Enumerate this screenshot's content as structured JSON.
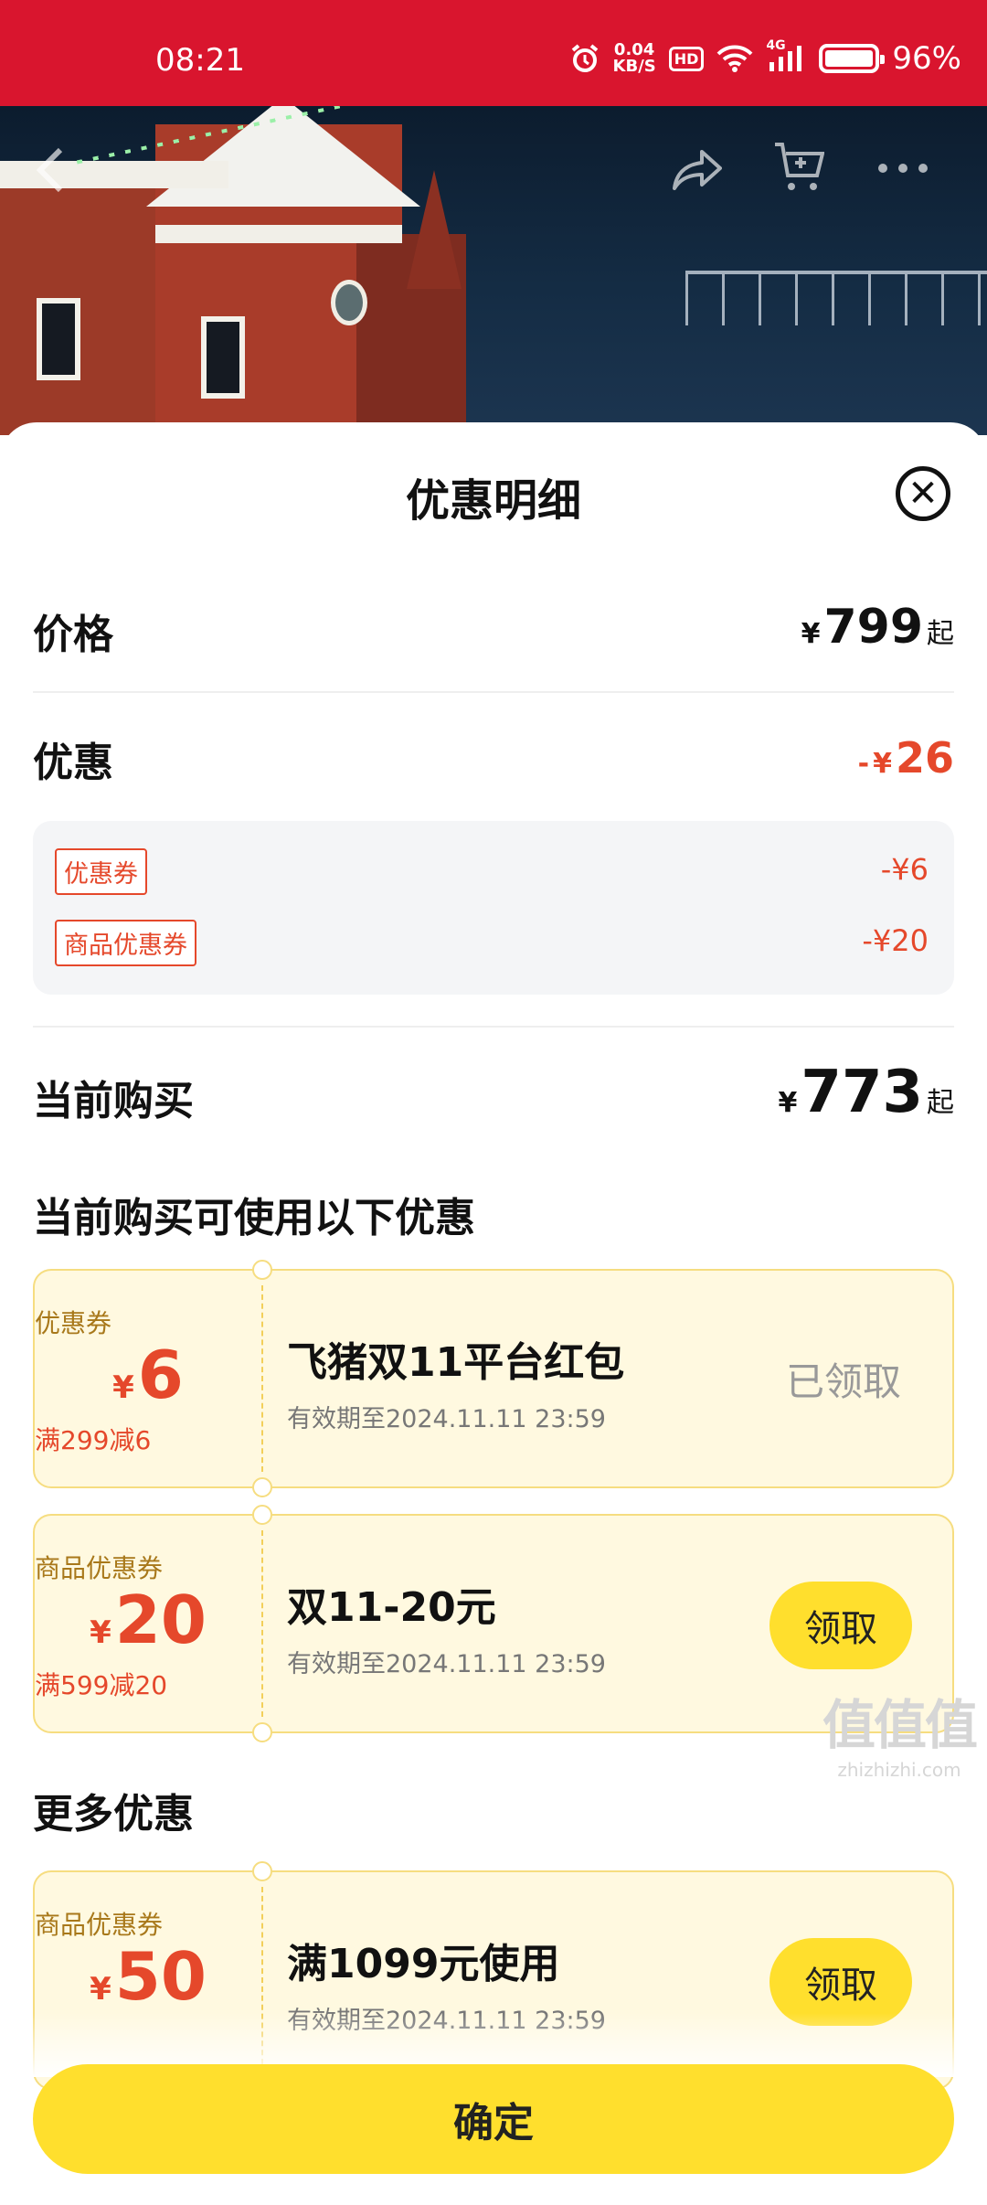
{
  "status_bar": {
    "time": "08:21",
    "net_speed_value": "0.04",
    "net_speed_unit": "KB/S",
    "hd": "HD",
    "signal": "4G",
    "battery": "96%"
  },
  "colors": {
    "status_bar_bg": "#d9152e",
    "accent_red": "#e5482b",
    "accent_yellow": "#ffdf2d",
    "coupon_bg": "#fff9e0"
  },
  "icons": {
    "back": "back-arrow-icon",
    "share": "share-icon",
    "cart": "cart-icon",
    "more": "more-icon",
    "close": "close-icon"
  },
  "sheet": {
    "title": "优惠明细",
    "close_symbol": "✕",
    "price": {
      "label": "价格",
      "currency": "¥",
      "value": "799",
      "suffix": "起"
    },
    "discount": {
      "label": "优惠",
      "prefix": "-",
      "currency": "¥",
      "value": "26",
      "items": [
        {
          "tag": "优惠券",
          "value": "-¥6"
        },
        {
          "tag": "商品优惠券",
          "value": "-¥20"
        }
      ]
    },
    "current": {
      "label": "当前购买",
      "currency": "¥",
      "value": "773",
      "suffix": "起"
    },
    "available_title": "当前购买可使用以下优惠",
    "coupons": [
      {
        "type": "优惠券",
        "currency": "¥",
        "amount": "6",
        "condition": "满299减6",
        "name": "飞猪双11平台红包",
        "validity": "有效期至2024.11.11 23:59",
        "status": "已领取"
      },
      {
        "type": "商品优惠券",
        "currency": "¥",
        "amount": "20",
        "condition": "满599减20",
        "name": "双11-20元",
        "validity": "有效期至2024.11.11 23:59",
        "button": "领取"
      }
    ],
    "more_title": "更多优惠",
    "more_coupons": [
      {
        "type": "商品优惠券",
        "currency": "¥",
        "amount": "50",
        "name": "满1099元使用",
        "validity": "有效期至2024.11.11 23:59",
        "button": "领取"
      }
    ],
    "confirm": "确定"
  },
  "watermark": {
    "main": "值值值",
    "sub": "zhizhizhi.com"
  }
}
